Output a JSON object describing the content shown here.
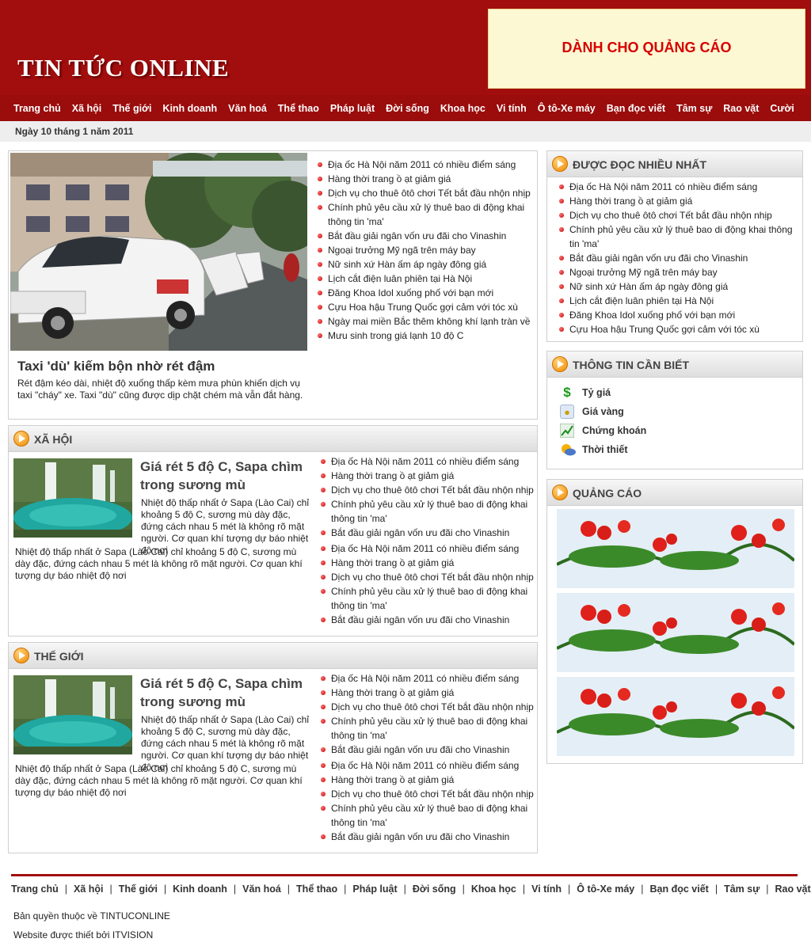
{
  "header": {
    "site_title": "TIN TỨC ONLINE",
    "ad_text": "DÀNH CHO QUẢNG CÁO"
  },
  "nav": [
    "Trang chủ",
    "Xã hội",
    "Thế giới",
    "Kinh doanh",
    "Văn hoá",
    "Thể thao",
    "Pháp luật",
    "Đời sống",
    "Khoa học",
    "Vi tính",
    "Ô tô-Xe máy",
    "Bạn đọc viết",
    "Tâm sự",
    "Rao vặt",
    "Cười"
  ],
  "date": "Ngày 10 tháng 1 năm 2011",
  "featured": {
    "title": "Taxi 'dù' kiếm bộn nhờ rét đậm",
    "desc": "Rét đậm kéo dài, nhiệt độ xuống thấp kèm mưa phùn khiến dịch vụ taxi \"cháy\" xe. Taxi \"dù\" cũng được dịp chặt chém mà vẫn đắt hàng.",
    "links": [
      "Địa ốc Hà Nội năm 2011 có nhiều điểm sáng",
      "Hàng thời trang ồ ạt giảm giá",
      "Dịch vụ cho thuê ôtô chơi Tết bắt đầu nhộn nhịp",
      "Chính phủ yêu cầu xử lý thuê bao di động khai thông tin 'ma'",
      "Bắt đầu giải ngân vốn ưu đãi cho Vinashin",
      "Ngoại trưởng Mỹ ngã trên máy bay",
      "Nữ sinh xứ Hàn ấm áp ngày đông giá",
      "Lịch cắt điện luân phiên tại Hà Nội",
      "Đăng Khoa Idol xuống phố với bạn mới",
      "Cựu Hoa hậu Trung Quốc gợi cảm với tóc xù",
      "Ngày mai miền Bắc thêm không khí lạnh tràn về",
      "Mưu sinh trong giá lạnh 10 độ C"
    ]
  },
  "sections": [
    {
      "heading": "XÃ HỘI",
      "title": "Giá rét 5 độ C, Sapa chìm trong sương mù",
      "desc": "Nhiệt độ thấp nhất ở Sapa (Lào Cai) chỉ khoảng 5 độ C, sương mù dày đặc, đứng cách nhau 5 mét là không rõ mặt người. Cơ quan khí tượng dự báo nhiệt độ nơi",
      "desc2": "Nhiệt độ thấp nhất ở Sapa (Lào Cai) chỉ khoảng 5 độ C, sương mù dày đặc, đứng cách nhau 5 mét là không rõ mặt người. Cơ quan khí tượng dự báo nhiệt độ nơi",
      "links": [
        "Địa ốc Hà Nội năm 2011 có nhiều điểm sáng",
        "Hàng thời trang ồ ạt giảm giá",
        "Dịch vụ cho thuê ôtô chơi Tết bắt đầu nhộn nhịp",
        "Chính phủ yêu cầu xử lý thuê bao di động khai thông tin 'ma'",
        "Bắt đầu giải ngân vốn ưu đãi cho Vinashin",
        "Địa ốc Hà Nội năm 2011 có nhiều điểm sáng",
        "Hàng thời trang ồ ạt giảm giá",
        "Dịch vụ cho thuê ôtô chơi Tết bắt đầu nhộn nhịp",
        "Chính phủ yêu cầu xử lý thuê bao di động khai thông tin 'ma'",
        "Bắt đầu giải ngân vốn ưu đãi cho Vinashin"
      ]
    },
    {
      "heading": "THẾ GIỚI",
      "title": "Giá rét 5 độ C, Sapa chìm trong sương mù",
      "desc": "Nhiệt độ thấp nhất ở Sapa (Lào Cai) chỉ khoảng 5 độ C, sương mù dày đặc, đứng cách nhau 5 mét là không rõ mặt người. Cơ quan khí tượng dự báo nhiệt độ nơi",
      "desc2": "Nhiệt độ thấp nhất ở Sapa (Lào Cai) chỉ khoảng 5 độ C, sương mù dày đặc, đứng cách nhau 5 mét là không rõ mặt người. Cơ quan khí tượng dự báo nhiệt độ nơi",
      "links": [
        "Địa ốc Hà Nội năm 2011 có nhiều điểm sáng",
        "Hàng thời trang ồ ạt giảm giá",
        "Dịch vụ cho thuê ôtô chơi Tết bắt đầu nhộn nhịp",
        "Chính phủ yêu cầu xử lý thuê bao di động khai thông tin 'ma'",
        "Bắt đầu giải ngân vốn ưu đãi cho Vinashin",
        "Địa ốc Hà Nội năm 2011 có nhiều điểm sáng",
        "Hàng thời trang ồ ạt giảm giá",
        "Dịch vụ cho thuê ôtô chơi Tết bắt đầu nhộn nhịp",
        "Chính phủ yêu cầu xử lý thuê bao di động khai thông tin 'ma'",
        "Bắt đầu giải ngân vốn ưu đãi cho Vinashin"
      ]
    }
  ],
  "most_read": {
    "heading": "ĐƯỢC ĐỌC NHIỀU NHẤT",
    "links": [
      "Địa ốc Hà Nội năm 2011 có nhiều điểm sáng",
      "Hàng thời trang ồ ạt giảm giá",
      "Dịch vụ cho thuê ôtô chơi Tết bắt đầu nhộn nhịp",
      "Chính phủ yêu cầu xử lý thuê bao di động khai thông tin 'ma'",
      "Bắt đầu giải ngân vốn ưu đãi cho Vinashin",
      "Ngoại trưởng Mỹ ngã trên máy bay",
      "Nữ sinh xứ Hàn ấm áp ngày đông giá",
      "Lịch cắt điện luân phiên tại Hà Nội",
      "Đăng Khoa Idol xuống phố với bạn mới",
      "Cựu Hoa hậu Trung Quốc gợi cảm với tóc xù"
    ]
  },
  "info": {
    "heading": "THÔNG TIN CẦN BIẾT",
    "items": [
      {
        "label": "Tỷ giá",
        "icon": "dollar-icon"
      },
      {
        "label": "Giá vàng",
        "icon": "gold-icon"
      },
      {
        "label": "Chứng khoán",
        "icon": "stock-chart-icon"
      },
      {
        "label": "Thời thiết",
        "icon": "weather-icon"
      }
    ]
  },
  "ads": {
    "heading": "QUẢNG CÁO"
  },
  "footer": {
    "copyright": "Bản quyền thuộc về TINTUCONLINE",
    "designer": "Website được thiết bởi ITVISION"
  },
  "colors": {
    "header_red": "#a20e0e",
    "ad_text_red": "#d60000",
    "ad_bg": "#fdf8d4",
    "bullet_red": "#c00000"
  }
}
